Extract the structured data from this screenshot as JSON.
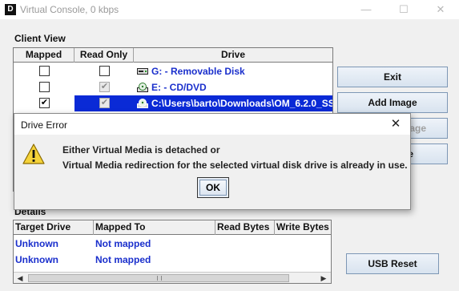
{
  "window": {
    "app_icon_letter": "D",
    "title": "Virtual Console, 0 kbps",
    "minimize_glyph": "—",
    "maximize_glyph": "☐",
    "close_glyph": "✕"
  },
  "client_view": {
    "label": "Client View",
    "columns": [
      "Mapped",
      "Read Only",
      "Drive"
    ],
    "rows": [
      {
        "mapped": false,
        "read_only": false,
        "read_only_disabled": false,
        "drive": "G: - Removable Disk",
        "icon": "removable-disk-icon",
        "selected": false
      },
      {
        "mapped": false,
        "read_only": true,
        "read_only_disabled": true,
        "drive": "E: - CD/DVD",
        "icon": "cd-dvd-icon",
        "selected": false
      },
      {
        "mapped": true,
        "read_only": true,
        "read_only_disabled": true,
        "drive": "C:\\Users\\barto\\Downloads\\OM_6.2.0_SS",
        "icon": "disk-image-icon",
        "selected": true
      }
    ]
  },
  "buttons": {
    "exit": "Exit",
    "add_image": "Add Image",
    "remove_image_partial": "age",
    "hidden_button_partial": "e",
    "usb_reset": "USB Reset"
  },
  "details": {
    "label": "Details",
    "columns": [
      "Target Drive",
      "Mapped To",
      "Read Bytes",
      "Write Bytes"
    ],
    "rows": [
      {
        "target_drive": "Unknown",
        "mapped_to": "Not mapped"
      },
      {
        "target_drive": "Unknown",
        "mapped_to": "Not mapped"
      }
    ]
  },
  "dialog": {
    "title": "Drive Error",
    "close_glyph": "✕",
    "message_line1": "Either Virtual Media is detached or",
    "message_line2": "Virtual Media redirection for the selected virtual disk drive is already in use.",
    "ok_label": "OK"
  },
  "colors": {
    "selection": "#0a2ad6",
    "link_text": "#1a2fcc",
    "warning_yellow": "#f5d33a"
  }
}
